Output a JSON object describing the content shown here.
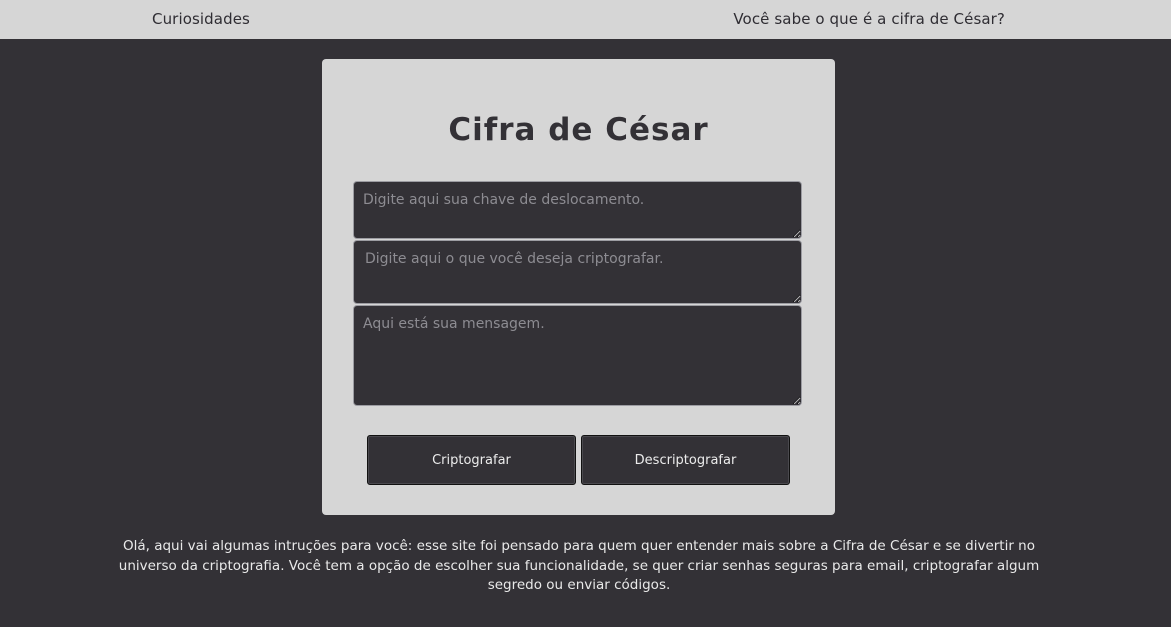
{
  "nav": {
    "left_link": "Curiosidades",
    "right_link": "Você sabe o que é a cifra de César?"
  },
  "card": {
    "title": "Cifra de César",
    "key_placeholder": "Digite aqui sua chave de deslocamento.",
    "message_placeholder": "Digite aqui o que você deseja criptografar.",
    "output_placeholder": "Aqui está sua mensagem.",
    "encrypt_label": "Criptografar",
    "decrypt_label": "Descriptografar"
  },
  "instructions": "Olá, aqui vai algumas intruções para você: esse site foi pensado para quem quer entender mais sobre a Cifra de César e se divertir no universo da criptografia. Você tem a opção de escolher sua funcionalidade, se quer criar senhas seguras para email, criptografar algum segredo ou enviar códigos.",
  "colors": {
    "background": "#333136",
    "panel": "#d6d6d6",
    "text_dark": "#333136",
    "text_light": "#e9e9e9"
  }
}
